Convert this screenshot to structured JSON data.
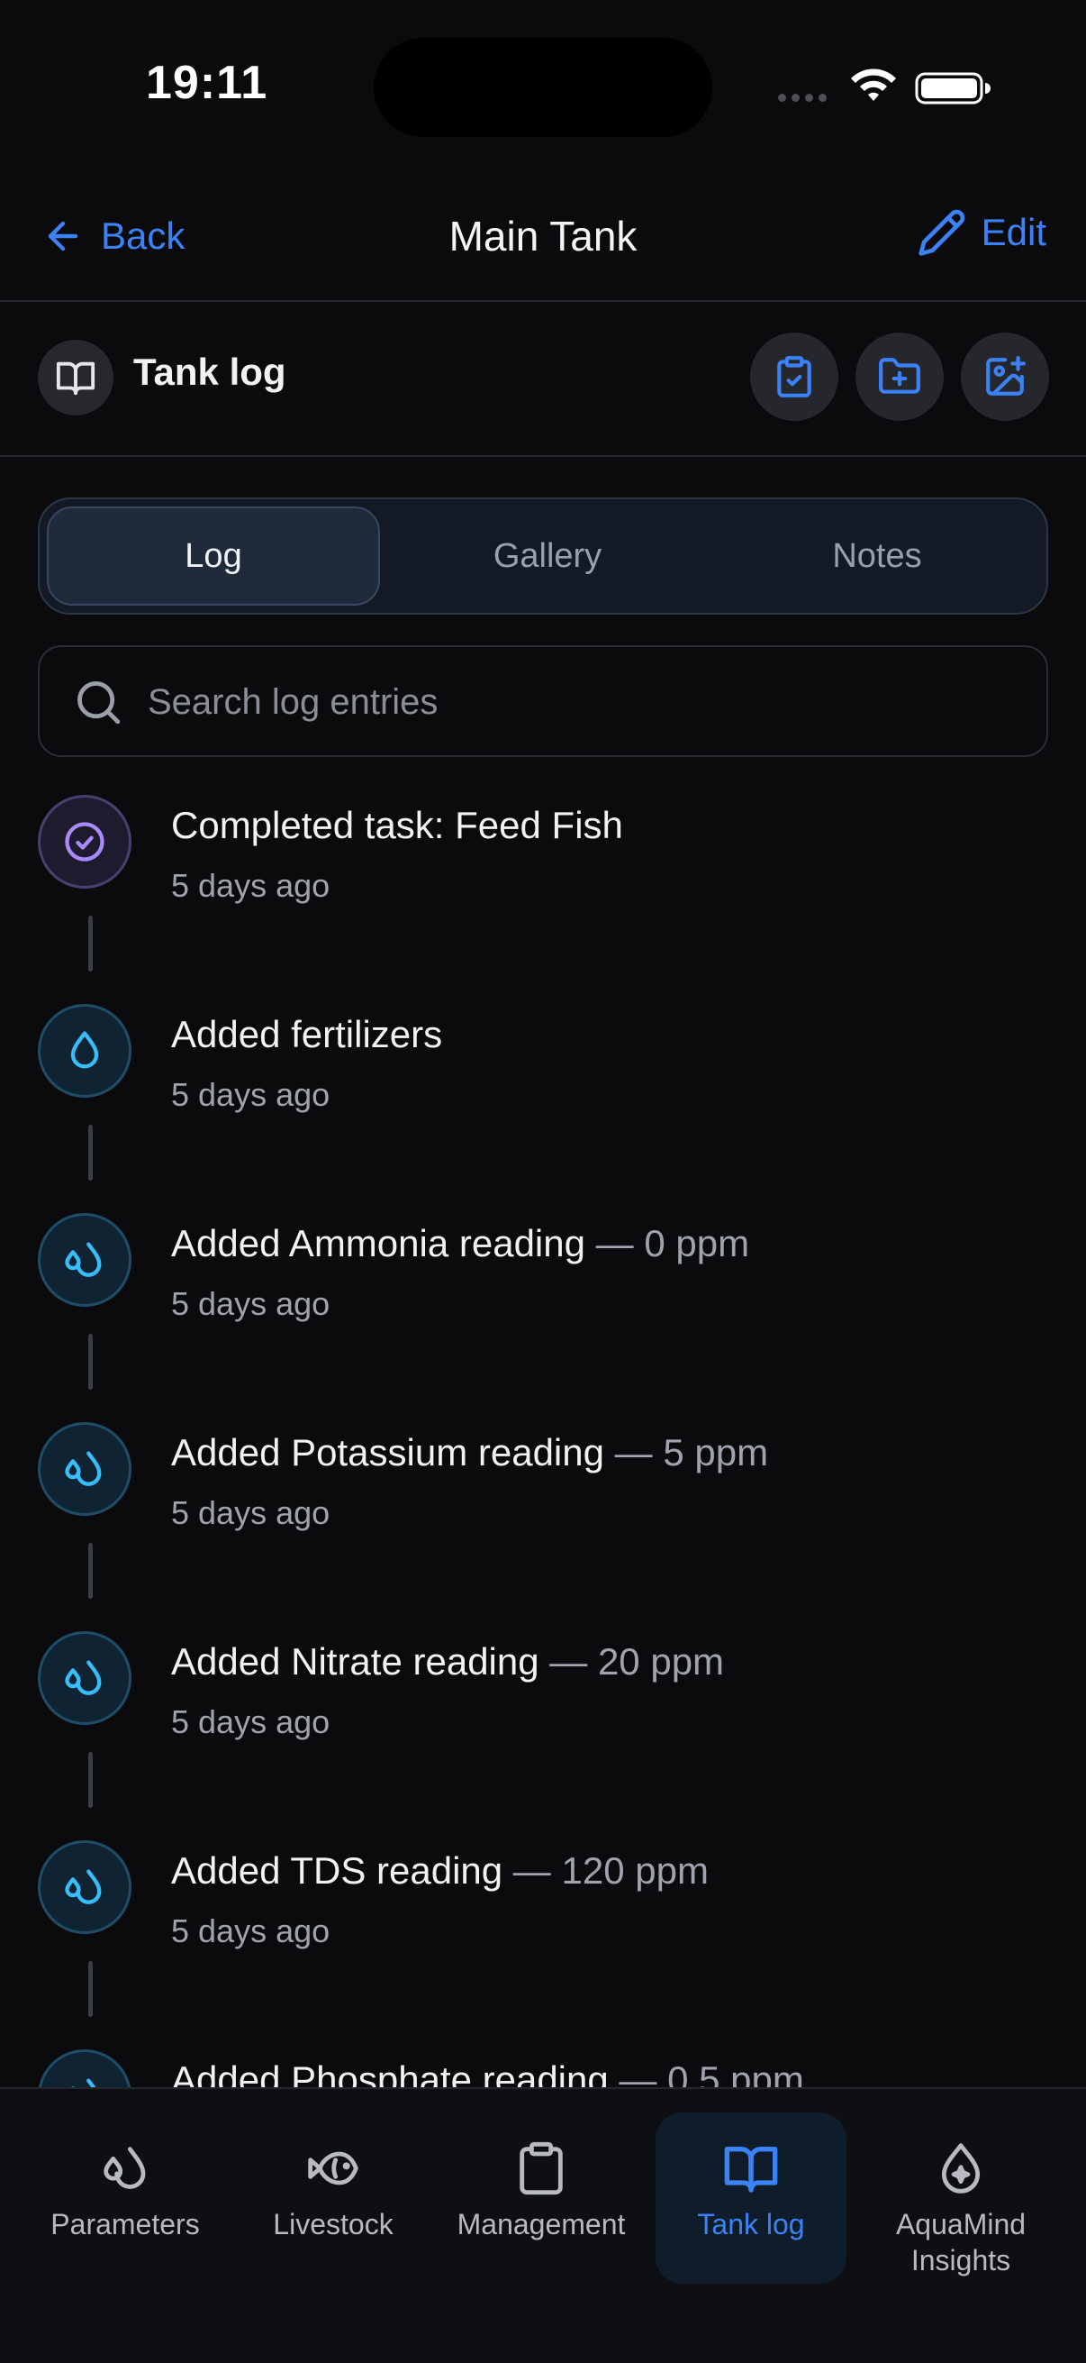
{
  "status_bar": {
    "time": "19:11"
  },
  "header": {
    "back_label": "Back",
    "title": "Main Tank",
    "edit_label": "Edit"
  },
  "section": {
    "title": "Tank log"
  },
  "segmented": {
    "tabs": [
      {
        "label": "Log",
        "active": true
      },
      {
        "label": "Gallery",
        "active": false
      },
      {
        "label": "Notes",
        "active": false
      }
    ]
  },
  "search": {
    "placeholder": "Search log entries",
    "value": ""
  },
  "entries": [
    {
      "title": "Completed task: Feed Fish",
      "value": "",
      "time": "5 days ago",
      "icon": "check-circle-icon",
      "color": "#a78bfa"
    },
    {
      "title": "Added fertilizers",
      "value": "",
      "time": "5 days ago",
      "icon": "droplet-icon",
      "color": "#38bdf8"
    },
    {
      "title": "Added Ammonia reading",
      "value": " — 0 ppm",
      "time": "5 days ago",
      "icon": "droplets-icon",
      "color": "#38bdf8"
    },
    {
      "title": "Added Potassium reading",
      "value": " — 5 ppm",
      "time": "5 days ago",
      "icon": "droplets-icon",
      "color": "#38bdf8"
    },
    {
      "title": "Added Nitrate reading",
      "value": " — 20 ppm",
      "time": "5 days ago",
      "icon": "droplets-icon",
      "color": "#38bdf8"
    },
    {
      "title": "Added TDS reading",
      "value": " — 120 ppm",
      "time": "5 days ago",
      "icon": "droplets-icon",
      "color": "#38bdf8"
    },
    {
      "title": "Added Phosphate reading",
      "value": " — 0.5 ppm",
      "time": "",
      "icon": "droplets-icon",
      "color": "#38bdf8"
    }
  ],
  "tabbar": {
    "items": [
      {
        "label": "Parameters",
        "icon": "droplets-icon",
        "active": false
      },
      {
        "label": "Livestock",
        "icon": "fish-icon",
        "active": false
      },
      {
        "label": "Management",
        "icon": "clipboard-icon",
        "active": false
      },
      {
        "label": "Tank log",
        "icon": "book-open-icon",
        "active": true
      },
      {
        "label": "AquaMind Insights",
        "icon": "sparkle-drop-icon",
        "active": false
      }
    ]
  },
  "colors": {
    "accent": "#3b82f6",
    "background": "#0b0b0d",
    "purple": "#a78bfa",
    "cyan": "#38bdf8"
  }
}
